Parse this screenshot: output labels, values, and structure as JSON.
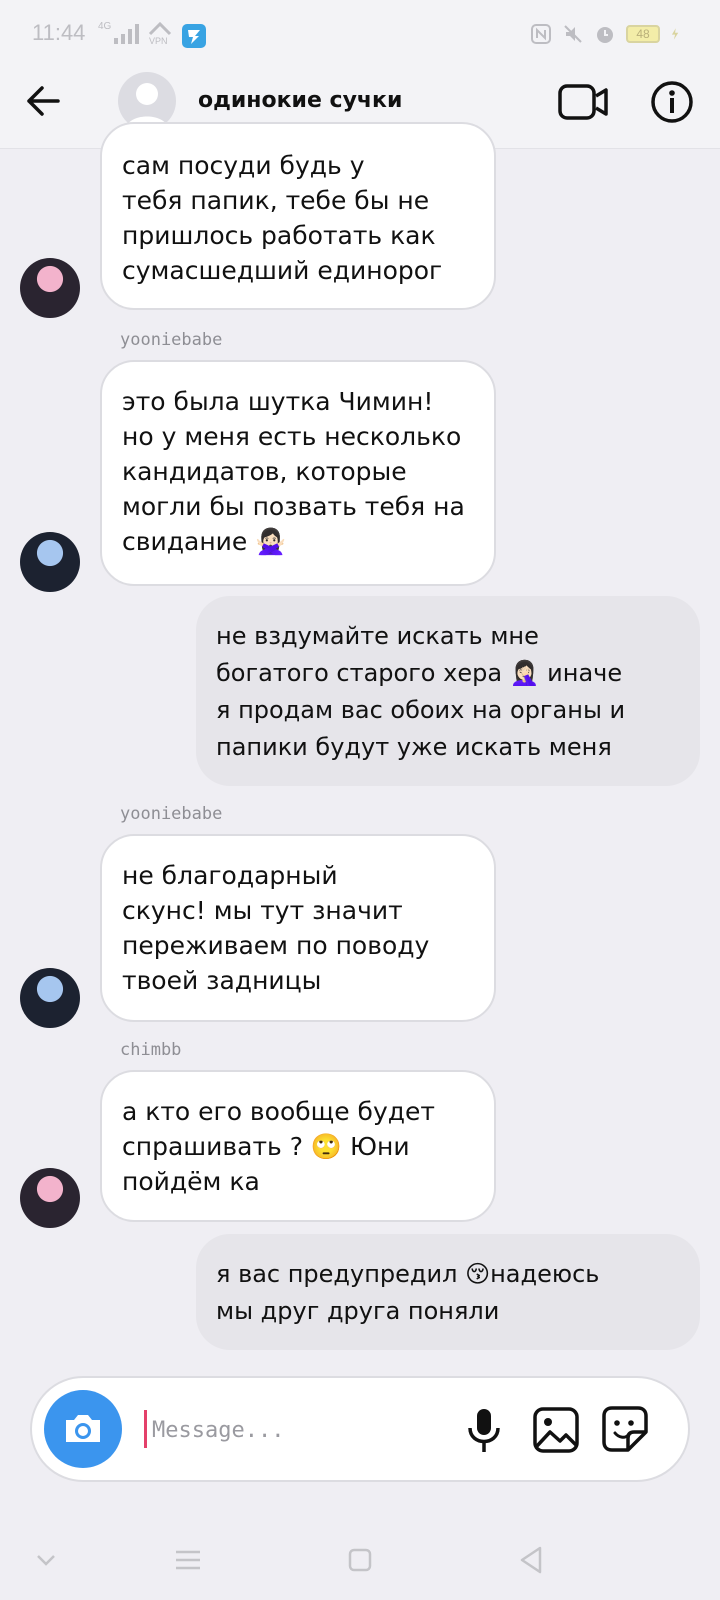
{
  "status_bar": {
    "time": "11:44",
    "network": "4G",
    "vpn_label": "VPN",
    "battery": "48"
  },
  "header": {
    "title": "одинокие сучки"
  },
  "messages": [
    {
      "direction": "in",
      "text": "сам посуди будь у\nтебя папик, тебе бы не\nпришлось работать как\nсумасшедший единорог",
      "avatar": "pink-hair-avatar"
    },
    {
      "direction": "in",
      "sender": "yooniebabe",
      "text": "это была шутка Чимин!\nно у меня есть несколько\nкандидатов, которые\nмогли бы позвать тебя на\nсвидание 🙅🏻‍♀️",
      "avatar": "blue-hair-avatar"
    },
    {
      "direction": "out",
      "text": "не вздумайте искать мне\nбогатого старого хера 🤦🏻‍♀️ иначе\nя продам вас обоих на органы и\nпапики будут уже искать меня"
    },
    {
      "direction": "in",
      "sender": "yooniebabe",
      "text": "не благодарный\nскунс! мы тут значит\nпереживаем по поводу\nтвоей задницы",
      "avatar": "blue-hair-avatar"
    },
    {
      "direction": "in",
      "sender": "chimbb",
      "text": "а кто его вообще будет\nспрашивать ? 🙄 Юни\nпойдём ка",
      "avatar": "pink-hair-avatar"
    },
    {
      "direction": "out",
      "text": "я вас предупредил 😚надеюсь\nмы друг друга поняли"
    }
  ],
  "composer": {
    "placeholder": "Message..."
  },
  "icons": {
    "back": "arrow-left-icon",
    "video": "video-camera-icon",
    "info": "info-icon",
    "camera": "camera-icon",
    "mic": "microphone-icon",
    "gallery": "image-icon",
    "sticker": "sticker-icon"
  },
  "colors": {
    "accent": "#3b95ee",
    "cursor": "#e4406a",
    "background": "#efeef3"
  }
}
